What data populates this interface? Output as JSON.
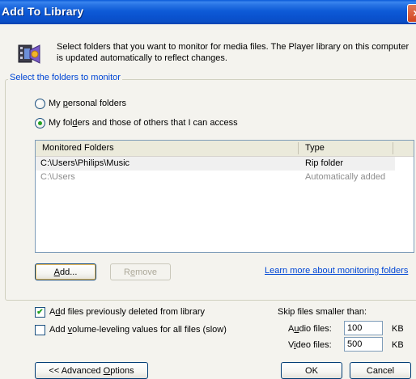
{
  "window": {
    "title": "Add To Library",
    "close_glyph": "×"
  },
  "description": "Select folders that you want to monitor for media files. The Player library on this computer is updated automatically to reflect changes.",
  "group_title": "Select the folders to monitor",
  "options": {
    "personal": {
      "pre": "My ",
      "key": "p",
      "post": "ersonal folders",
      "checked": false
    },
    "others": {
      "pre": "My fol",
      "key": "d",
      "post": "ers and those of others that I can access",
      "checked": true
    }
  },
  "folders": {
    "columns": [
      "Monitored Folders",
      "Type"
    ],
    "rows": [
      {
        "path": "C:\\Users\\Philips\\Music",
        "type": "Rip folder",
        "dimmed": false
      },
      {
        "path": "C:\\Users",
        "type": "Automatically added",
        "dimmed": true
      }
    ]
  },
  "buttons": {
    "add": {
      "key": "A",
      "rest": "dd..."
    },
    "remove": {
      "pre": "R",
      "key": "e",
      "rest": "move"
    },
    "advanced": {
      "pre": "<< Advanced ",
      "key": "O",
      "rest": "ptions"
    },
    "ok": "OK",
    "cancel": "Cancel"
  },
  "learn_more_link": "Learn more about monitoring folders",
  "checkboxes": {
    "add_deleted": {
      "pre": "A",
      "key": "d",
      "rest": "d files previously deleted from library",
      "checked": true
    },
    "volume_leveling": {
      "pre": "Add ",
      "key": "v",
      "rest": "olume-leveling values for all files (slow)",
      "checked": false
    }
  },
  "skip": {
    "title": "Skip files smaller than:",
    "audio": {
      "pre": "A",
      "key": "u",
      "rest": "dio files:",
      "value": "100",
      "unit": "KB"
    },
    "video": {
      "pre": "V",
      "key": "i",
      "rest": "deo files:",
      "value": "500",
      "unit": "KB"
    }
  },
  "check_glyph": "✔",
  "colors": {
    "titlebar": "#0a52cf",
    "dialog_bg": "#f4f3ee",
    "link": "#0046d5",
    "group_title": "#0046d5"
  }
}
